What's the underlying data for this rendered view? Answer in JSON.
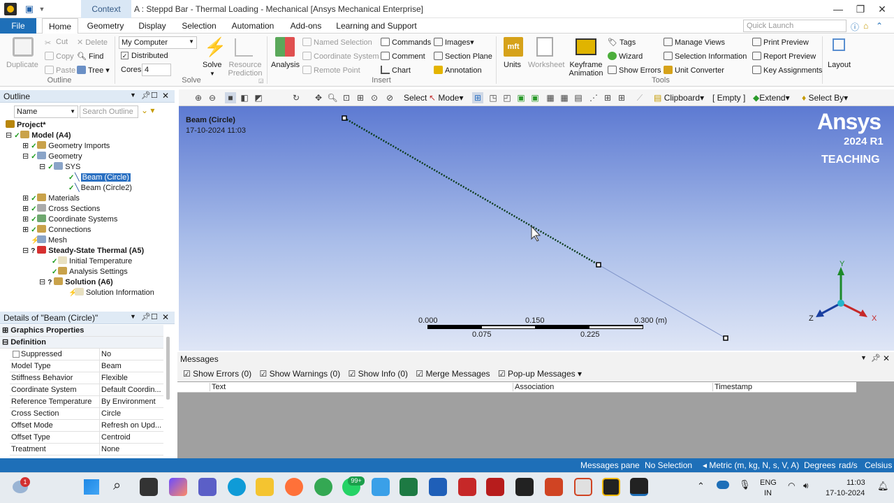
{
  "titlebar": {
    "context_tab": "Context",
    "title": "A : Steppd Bar - Thermal Loading - Mechanical [Ansys Mechanical Enterprise]"
  },
  "menu": {
    "file": "File",
    "tabs": [
      "Home",
      "Geometry",
      "Display",
      "Selection",
      "Automation",
      "Add-ons",
      "Learning and Support"
    ],
    "quick_launch_placeholder": "Quick Launch"
  },
  "ribbon": {
    "outline": {
      "duplicate": "Duplicate",
      "cut": "Cut",
      "copy": "Copy",
      "paste": "Paste",
      "delete": "Delete",
      "find": "Find",
      "tree": "Tree",
      "group": "Outline"
    },
    "solve": {
      "computer": "My Computer",
      "distributed": "Distributed",
      "cores_label": "Cores",
      "cores_value": "4",
      "solve": "Solve",
      "resource_prediction": "Resource Prediction",
      "group": "Solve"
    },
    "insert": {
      "analysis": "Analysis",
      "named_selection": "Named Selection",
      "coordinate_system": "Coordinate System",
      "remote_point": "Remote Point",
      "commands": "Commands",
      "comment": "Comment",
      "chart": "Chart",
      "images": "Images",
      "section_plane": "Section Plane",
      "annotation": "Annotation",
      "group": "Insert"
    },
    "tools": {
      "units": "Units",
      "worksheet": "Worksheet",
      "keyframe_animation": "Keyframe Animation",
      "tags": "Tags",
      "wizard": "Wizard",
      "show_errors": "Show Errors",
      "manage_views": "Manage Views",
      "selection_information": "Selection Information",
      "unit_converter": "Unit Converter",
      "print_preview": "Print Preview",
      "report_preview": "Report Preview",
      "key_assignments": "Key Assignments",
      "group": "Tools"
    },
    "layout": "Layout"
  },
  "toolbar": {
    "select": "Select",
    "mode": "Mode",
    "clipboard": "Clipboard",
    "empty": "[ Empty ]",
    "extend": "Extend",
    "select_by": "Select By"
  },
  "outline": {
    "title": "Outline",
    "filter_name": "Name",
    "search_placeholder": "Search Outline",
    "tree": [
      {
        "label": "Project*",
        "bold": true
      },
      {
        "label": "Model (A4)",
        "bold": true
      },
      {
        "label": "Geometry Imports"
      },
      {
        "label": "Geometry"
      },
      {
        "label": "SYS"
      },
      {
        "label": "Beam (Circle)",
        "selected": true
      },
      {
        "label": "Beam (Circle2)"
      },
      {
        "label": "Materials"
      },
      {
        "label": "Cross Sections"
      },
      {
        "label": "Coordinate Systems"
      },
      {
        "label": "Connections"
      },
      {
        "label": "Mesh"
      },
      {
        "label": "Steady-State Thermal (A5)",
        "bold": true
      },
      {
        "label": "Initial Temperature"
      },
      {
        "label": "Analysis Settings"
      },
      {
        "label": "Solution (A6)",
        "bold": true
      },
      {
        "label": "Solution Information"
      }
    ]
  },
  "details": {
    "title": "Details of \"Beam (Circle)\"",
    "sections": [
      "Graphics Properties",
      "Definition"
    ],
    "rows": [
      {
        "key": "Suppressed",
        "value": "No"
      },
      {
        "key": "Model Type",
        "value": "Beam"
      },
      {
        "key": "Stiffness Behavior",
        "value": "Flexible"
      },
      {
        "key": "Coordinate System",
        "value": "Default Coordin..."
      },
      {
        "key": "Reference Temperature",
        "value": "By Environment"
      },
      {
        "key": "Cross Section",
        "value": "Circle"
      },
      {
        "key": "Offset Mode",
        "value": "Refresh on Upd..."
      },
      {
        "key": "Offset Type",
        "value": "Centroid"
      },
      {
        "key": "Treatment",
        "value": "None"
      }
    ]
  },
  "viewport": {
    "object_name": "Beam (Circle)",
    "date": "17-10-2024 11:03",
    "brand": "Ansys",
    "version": "2024 R1",
    "edition": "TEACHING",
    "scale_top": [
      "0.000",
      "0.150",
      "0.300 (m)"
    ],
    "scale_bottom": [
      "0.075",
      "0.225"
    ],
    "triad": {
      "y": "Y",
      "z": "Z",
      "x": "X"
    }
  },
  "messages": {
    "title": "Messages",
    "show_errors": "Show Errors",
    "errors_count": "(0)",
    "show_warnings": "Show Warnings",
    "warnings_count": "(0)",
    "show_info": "Show Info",
    "info_count": "(0)",
    "merge_messages": "Merge Messages",
    "popup_messages": "Pop-up Messages",
    "columns": [
      "Text",
      "Association",
      "Timestamp"
    ]
  },
  "status": {
    "messages_pane": "Messages pane",
    "selection": "No Selection",
    "units": "Metric (m, kg, N, s, V, A)",
    "degrees": "Degrees",
    "rads": "rad/s",
    "temp": "Celsius"
  },
  "taskbar": {
    "weather_badge": "1",
    "whatsapp_badge": "99+",
    "lang": "ENG",
    "region": "IN",
    "time": "11:03",
    "date": "17-10-2024"
  },
  "colors": {
    "accent": "#1e6fb8",
    "selection": "#2a70c2",
    "viewport_top": "#5d7ad2",
    "viewport_bottom": "#dfe6f6"
  }
}
